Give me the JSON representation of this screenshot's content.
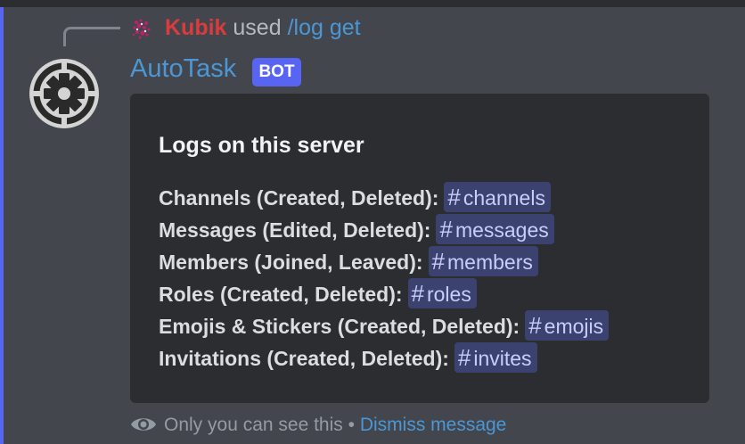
{
  "reply": {
    "user": "Kubik",
    "used_text": "used",
    "command": "/log get"
  },
  "author": {
    "name": "AutoTask",
    "tag": "BOT"
  },
  "embed": {
    "title": "Logs on this server",
    "rows": [
      {
        "label": "Channels (Created, Deleted):",
        "channel": "channels"
      },
      {
        "label": "Messages (Edited, Deleted):",
        "channel": "messages"
      },
      {
        "label": "Members (Joined, Leaved):",
        "channel": "members"
      },
      {
        "label": "Roles (Created, Deleted):",
        "channel": "roles"
      },
      {
        "label": "Emojis & Stickers (Created, Deleted):",
        "channel": "emojis"
      },
      {
        "label": "Invitations (Created, Deleted):",
        "channel": "invites"
      }
    ]
  },
  "footer": {
    "ephemeral_text": "Only you can see this",
    "separator": "•",
    "dismiss_label": "Dismiss message"
  },
  "colors": {
    "accent": "#5865f2",
    "link": "#4b97d6",
    "reply_user": "#d83c3e",
    "mention_bg": "#3c4270"
  }
}
